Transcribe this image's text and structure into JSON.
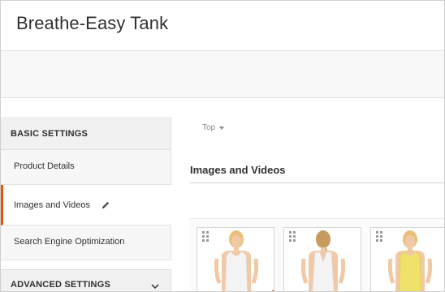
{
  "header": {
    "title": "Breathe-Easy Tank"
  },
  "sidebar": {
    "basic_settings_label": "BASIC SETTINGS",
    "items": [
      {
        "label": "Product Details",
        "active": false
      },
      {
        "label": "Images and Videos",
        "active": true
      },
      {
        "label": "Search Engine Optimization",
        "active": false
      }
    ],
    "advanced_settings_label": "ADVANCED SETTINGS"
  },
  "main": {
    "store_switcher": "Top",
    "section_title": "Images and Videos",
    "images": [
      {
        "name": "white tank front",
        "tank_color": "#f4f4f4",
        "role_badge": true
      },
      {
        "name": "white tank back",
        "tank_color": "#f4f4f4",
        "role_badge": false
      },
      {
        "name": "yellow tank front",
        "tank_color": "#efe26a",
        "role_badge": false
      }
    ]
  },
  "colors": {
    "accent": "#eb5202",
    "sidebar_bg": "#f1f1f1",
    "toolbar_bg": "#f8f8f8"
  },
  "icons": [
    "pencil-icon",
    "chevron-down-icon",
    "drag-handle-icon",
    "caret-down-icon"
  ]
}
